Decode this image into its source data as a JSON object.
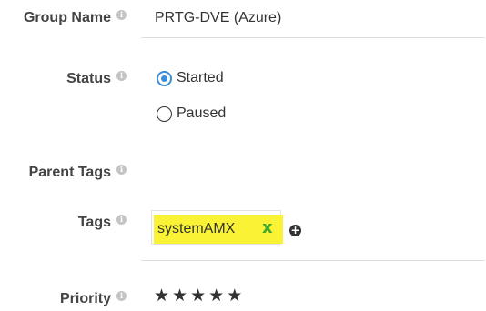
{
  "form": {
    "group_name": {
      "label": "Group Name",
      "value": "PRTG-DVE (Azure)",
      "info_icon": "info-icon"
    },
    "status": {
      "label": "Status",
      "info_icon": "info-icon",
      "options": [
        {
          "label": "Started",
          "checked": true
        },
        {
          "label": "Paused",
          "checked": false
        }
      ],
      "accent_color": "#3a8fd6"
    },
    "parent_tags": {
      "label": "Parent Tags",
      "info_icon": "info-icon"
    },
    "tags": {
      "label": "Tags",
      "info_icon": "info-icon",
      "items": [
        {
          "label": "systemAMX",
          "remove_glyph": "x",
          "highlight_color": "#faf234",
          "remove_color": "#3fa832"
        }
      ],
      "add_icon": "plus-circle-icon"
    },
    "priority": {
      "label": "Priority",
      "info_icon": "info-icon",
      "stars_filled": 5,
      "stars_total": 5
    }
  }
}
